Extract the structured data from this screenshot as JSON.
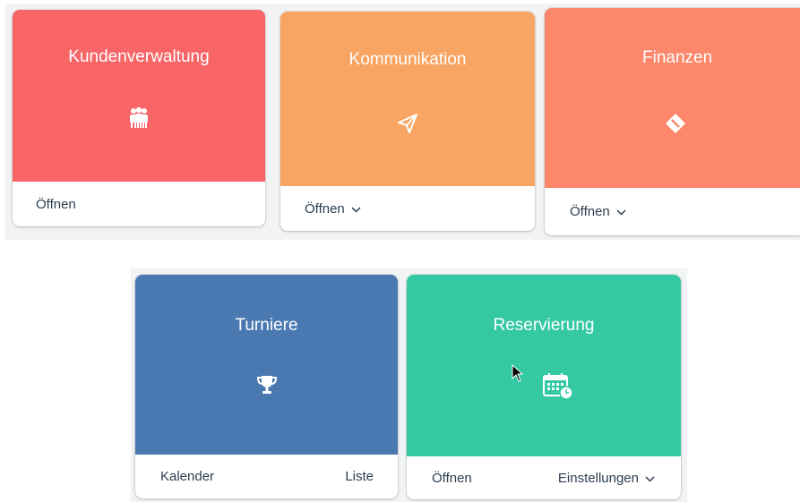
{
  "cards": [
    {
      "title": "Kundenverwaltung",
      "icon": "people-group-icon",
      "color": "#f76567",
      "actions": [
        {
          "label": "Öffnen",
          "dropdown": false
        }
      ]
    },
    {
      "title": "Kommunikation",
      "icon": "paper-plane-icon",
      "color": "#f8a462",
      "actions": [
        {
          "label": "Öffnen",
          "dropdown": true
        }
      ]
    },
    {
      "title": "Finanzen",
      "icon": "tag-icon",
      "color": "#fd876a",
      "actions": [
        {
          "label": "Öffnen",
          "dropdown": true
        }
      ]
    },
    {
      "title": "Turniere",
      "icon": "trophy-icon",
      "color": "#4a79b2",
      "actions": [
        {
          "label": "Kalender",
          "dropdown": false
        },
        {
          "label": "Liste",
          "dropdown": false
        }
      ]
    },
    {
      "title": "Reservierung",
      "icon": "calendar-clock-icon",
      "color": "#34c9a3",
      "actions": [
        {
          "label": "Öffnen",
          "dropdown": false
        },
        {
          "label": "Einstellungen",
          "dropdown": true
        }
      ]
    }
  ],
  "colors": {
    "footer_text": "#2c3e50",
    "background_strip": "#f2f3f5"
  },
  "cursor_icon": "mouse-pointer-icon"
}
